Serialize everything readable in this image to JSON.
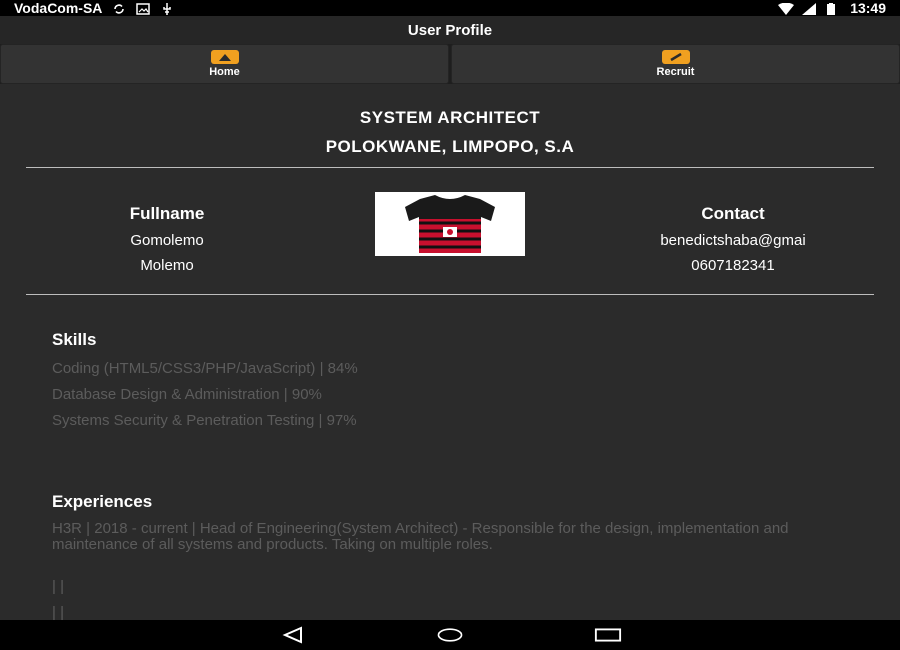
{
  "status_bar": {
    "carrier": "VodaCom-SA",
    "time": "13:49"
  },
  "app_bar": {
    "title": "User Profile"
  },
  "nav": {
    "items": [
      {
        "label": "Home",
        "icon": "home-icon"
      },
      {
        "label": "Recruit",
        "icon": "handshake-icon"
      }
    ]
  },
  "profile": {
    "title": "SYSTEM ARCHITECT",
    "location": "POLOKWANE, LIMPOPO, S.A",
    "fullname_label": "Fullname",
    "first_name": "Gomolemo",
    "last_name": "Molemo",
    "contact_label": "Contact",
    "email": "benedictshaba@gmai",
    "phone": "0607182341",
    "photo": "jersey-image"
  },
  "skills": {
    "title": "Skills",
    "items": [
      "Coding (HTML5/CSS3/PHP/JavaScript) | 84%",
      "Database Design & Administration | 90%",
      "Systems Security & Penetration Testing | 97%"
    ]
  },
  "experiences": {
    "title": "Experiences",
    "entry": "H3R | 2018 - current | Head of Engineering(System Architect) - Responsible for the design, implementation and maintenance of all systems and products. Taking on multiple roles.",
    "placeholders": [
      "| |",
      "| |"
    ]
  },
  "colors": {
    "background": "#2b2b2b",
    "accent": "#f0a020",
    "muted_text": "#5c5c5c"
  }
}
